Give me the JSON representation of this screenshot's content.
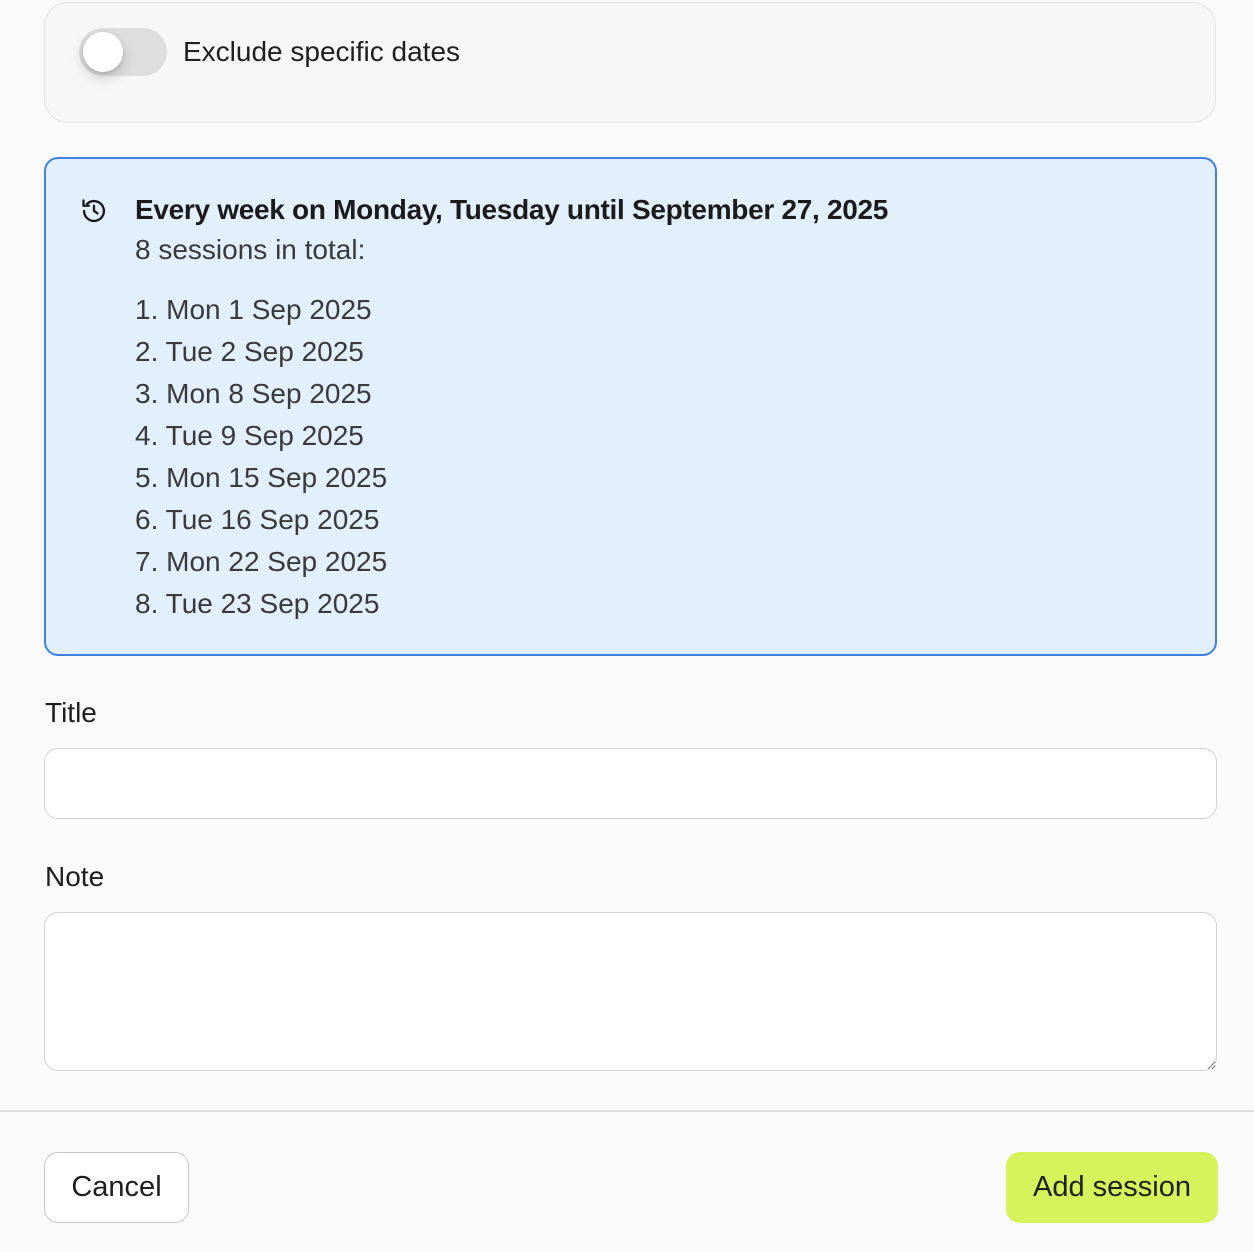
{
  "exclude": {
    "label": "Exclude specific dates",
    "enabled": false
  },
  "summary": {
    "icon": "history-icon",
    "title": "Every week on Monday, Tuesday until September 27, 2025",
    "count_text": "8 sessions in total:",
    "sessions": [
      "1. Mon 1 Sep 2025",
      "2. Tue 2 Sep 2025",
      "3. Mon 8 Sep 2025",
      "4. Tue 9 Sep 2025",
      "5. Mon 15 Sep 2025",
      "6. Tue 16 Sep 2025",
      "7. Mon 22 Sep 2025",
      "8. Tue 23 Sep 2025"
    ]
  },
  "form": {
    "title_label": "Title",
    "title_value": "",
    "note_label": "Note",
    "note_value": ""
  },
  "footer": {
    "cancel_label": "Cancel",
    "submit_label": "Add session"
  },
  "colors": {
    "summary_bg": "#e2effd",
    "summary_border": "#3f80e0",
    "submit_bg": "#d7f25a"
  }
}
